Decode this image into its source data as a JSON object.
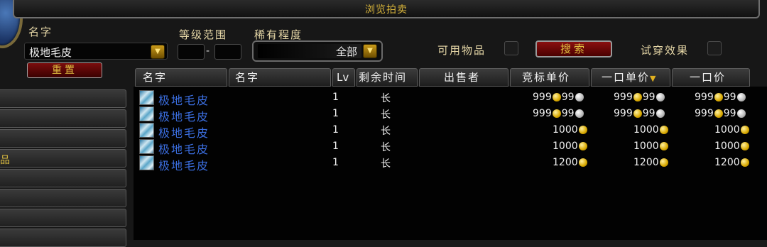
{
  "window_title": "浏览拍卖",
  "search": {
    "name_label": "名字",
    "name_value": "极地毛皮",
    "level_label": "等级范围",
    "level_dash": "-",
    "rarity_label": "稀有程度",
    "rarity_value": "全部",
    "usable_label": "可用物品",
    "search_button": "搜索",
    "preview_label": "试穿效果",
    "reset_button": "重置"
  },
  "categories": [
    "",
    "",
    "",
    "品",
    "",
    "",
    "",
    ""
  ],
  "columns": {
    "col_name": "名字",
    "col_name2": "名字",
    "col_lv": "Lv",
    "col_time": "剩余时间",
    "col_seller": "出售者",
    "col_bid": "竞标单价",
    "col_buyout_unit": "一口单价",
    "col_buyout": "一口价"
  },
  "results": [
    {
      "name": "极地毛皮",
      "level": "1",
      "time_left": "长",
      "seller": "",
      "bid": {
        "gold": "999",
        "silver": "99"
      },
      "buyout_unit": {
        "gold": "999",
        "silver": "99"
      },
      "buyout": {
        "gold": "999",
        "silver": "99"
      }
    },
    {
      "name": "极地毛皮",
      "level": "1",
      "time_left": "长",
      "seller": "",
      "bid": {
        "gold": "999",
        "silver": "99"
      },
      "buyout_unit": {
        "gold": "999",
        "silver": "99"
      },
      "buyout": {
        "gold": "999",
        "silver": "99"
      }
    },
    {
      "name": "极地毛皮",
      "level": "1",
      "time_left": "长",
      "seller": "",
      "bid": {
        "gold": "1000"
      },
      "buyout_unit": {
        "gold": "1000"
      },
      "buyout": {
        "gold": "1000"
      }
    },
    {
      "name": "极地毛皮",
      "level": "1",
      "time_left": "长",
      "seller": "",
      "bid": {
        "gold": "1000"
      },
      "buyout_unit": {
        "gold": "1000"
      },
      "buyout": {
        "gold": "1000"
      }
    },
    {
      "name": "极地毛皮",
      "level": "1",
      "time_left": "长",
      "seller": "",
      "bid": {
        "gold": "1200"
      },
      "buyout_unit": {
        "gold": "1200"
      },
      "buyout": {
        "gold": "1200"
      }
    }
  ],
  "colors": {
    "item_name": "#3b6ee0",
    "title_gold": "#d8b43a",
    "button_red": "#7a0d0d"
  },
  "icons": {
    "item": "fur-item-icon",
    "gold": "gold-coin-icon",
    "silver": "silver-coin-icon",
    "dropdown": "chevron-down-icon",
    "sort": "sort-arrow-icon"
  }
}
